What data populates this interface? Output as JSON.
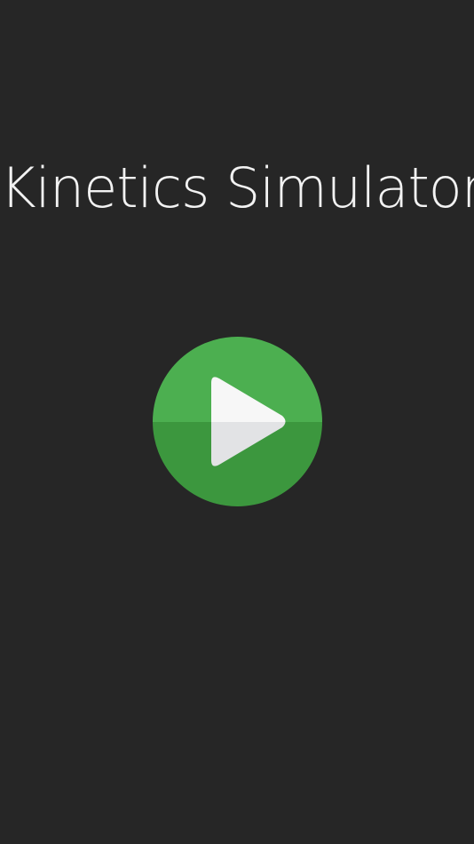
{
  "app": {
    "title": "Kinetics Simulator"
  },
  "play_button": {
    "icon": "play-icon",
    "aria_label": "Play"
  },
  "colors": {
    "background": "#262626",
    "title_text": "#f2f2f2",
    "button_green_top": "#4caf50",
    "button_green_bottom": "#3c973e",
    "triangle_top": "#f7f7f7",
    "triangle_bottom": "#e2e3e5"
  }
}
